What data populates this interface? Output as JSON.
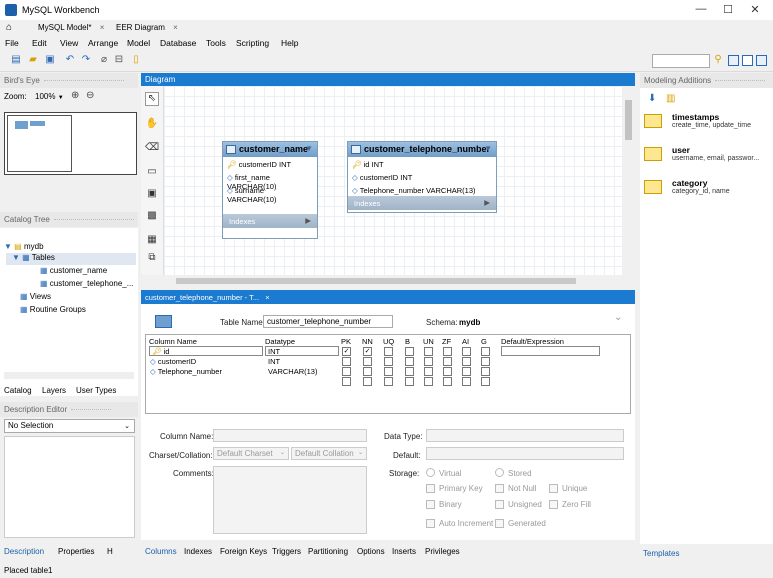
{
  "window": {
    "title": "MySQL Workbench"
  },
  "tabs": [
    {
      "label": "MySQL Model*",
      "close": "×"
    },
    {
      "label": "EER Diagram",
      "close": "×"
    }
  ],
  "menu": [
    "File",
    "Edit",
    "View",
    "Arrange",
    "Model",
    "Database",
    "Tools",
    "Scripting",
    "Help"
  ],
  "left": {
    "birds_eye": "Bird's Eye",
    "zoom_label": "Zoom:",
    "zoom_value": "100%",
    "catalog_tree": "Catalog Tree",
    "tree": {
      "schema": "mydb",
      "tables_label": "Tables",
      "tables": [
        "customer_name",
        "customer_telephone_..."
      ],
      "views": "Views",
      "routines": "Routine Groups"
    },
    "catalog_tabs": [
      "Catalog",
      "Layers",
      "User Types"
    ],
    "description_editor": "Description Editor",
    "description_select": "No Selection",
    "bottom_tabs": [
      "Description",
      "Properties",
      "H"
    ]
  },
  "diagram": {
    "title": "Diagram",
    "entities": [
      {
        "name": "customer_name",
        "columns": [
          "customerID INT",
          "first_name VARCHAR(10)",
          "surname VARCHAR(10)"
        ],
        "footer": "Indexes"
      },
      {
        "name": "customer_telephone_number",
        "columns": [
          "id INT",
          "customerID INT",
          "Telephone_number VARCHAR(13)"
        ],
        "footer": "Indexes"
      }
    ]
  },
  "editor": {
    "tab_label": "customer_telephone_number - T...",
    "tab_close": "×",
    "table_name_label": "Table Name:",
    "table_name": "customer_telephone_number",
    "schema_label": "Schema:",
    "schema": "mydb",
    "headers": [
      "Column Name",
      "Datatype",
      "PK",
      "NN",
      "UQ",
      "B",
      "UN",
      "ZF",
      "AI",
      "G",
      "Default/Expression"
    ],
    "rows": [
      {
        "name": "id",
        "type": "INT",
        "pk": true,
        "nn": true
      },
      {
        "name": "customerID",
        "type": "INT",
        "pk": false,
        "nn": false
      },
      {
        "name": "Telephone_number",
        "type": "VARCHAR(13)",
        "pk": false,
        "nn": false
      }
    ],
    "column_name_label": "Column Name:",
    "charset_label": "Charset/Collation:",
    "charset_value": "Default Charset",
    "collation_value": "Default Collation",
    "comments_label": "Comments:",
    "data_type_label": "Data Type:",
    "default_label": "Default:",
    "storage_label": "Storage:",
    "storage_options": [
      "Virtual",
      "Stored"
    ],
    "flags": [
      "Primary Key",
      "Not Null",
      "Unique",
      "Binary",
      "Unsigned",
      "Zero Fill",
      "Auto Increment",
      "Generated"
    ],
    "bottom_tabs": [
      "Columns",
      "Indexes",
      "Foreign Keys",
      "Triggers",
      "Partitioning",
      "Options",
      "Inserts",
      "Privileges"
    ]
  },
  "right": {
    "header": "Modeling Additions",
    "snippets": [
      {
        "title": "timestamps",
        "desc": "create_time, update_time"
      },
      {
        "title": "user",
        "desc": "username, email, passwor..."
      },
      {
        "title": "category",
        "desc": "category_id, name"
      }
    ],
    "bottom_tab": "Templates"
  },
  "status": "Placed table1"
}
